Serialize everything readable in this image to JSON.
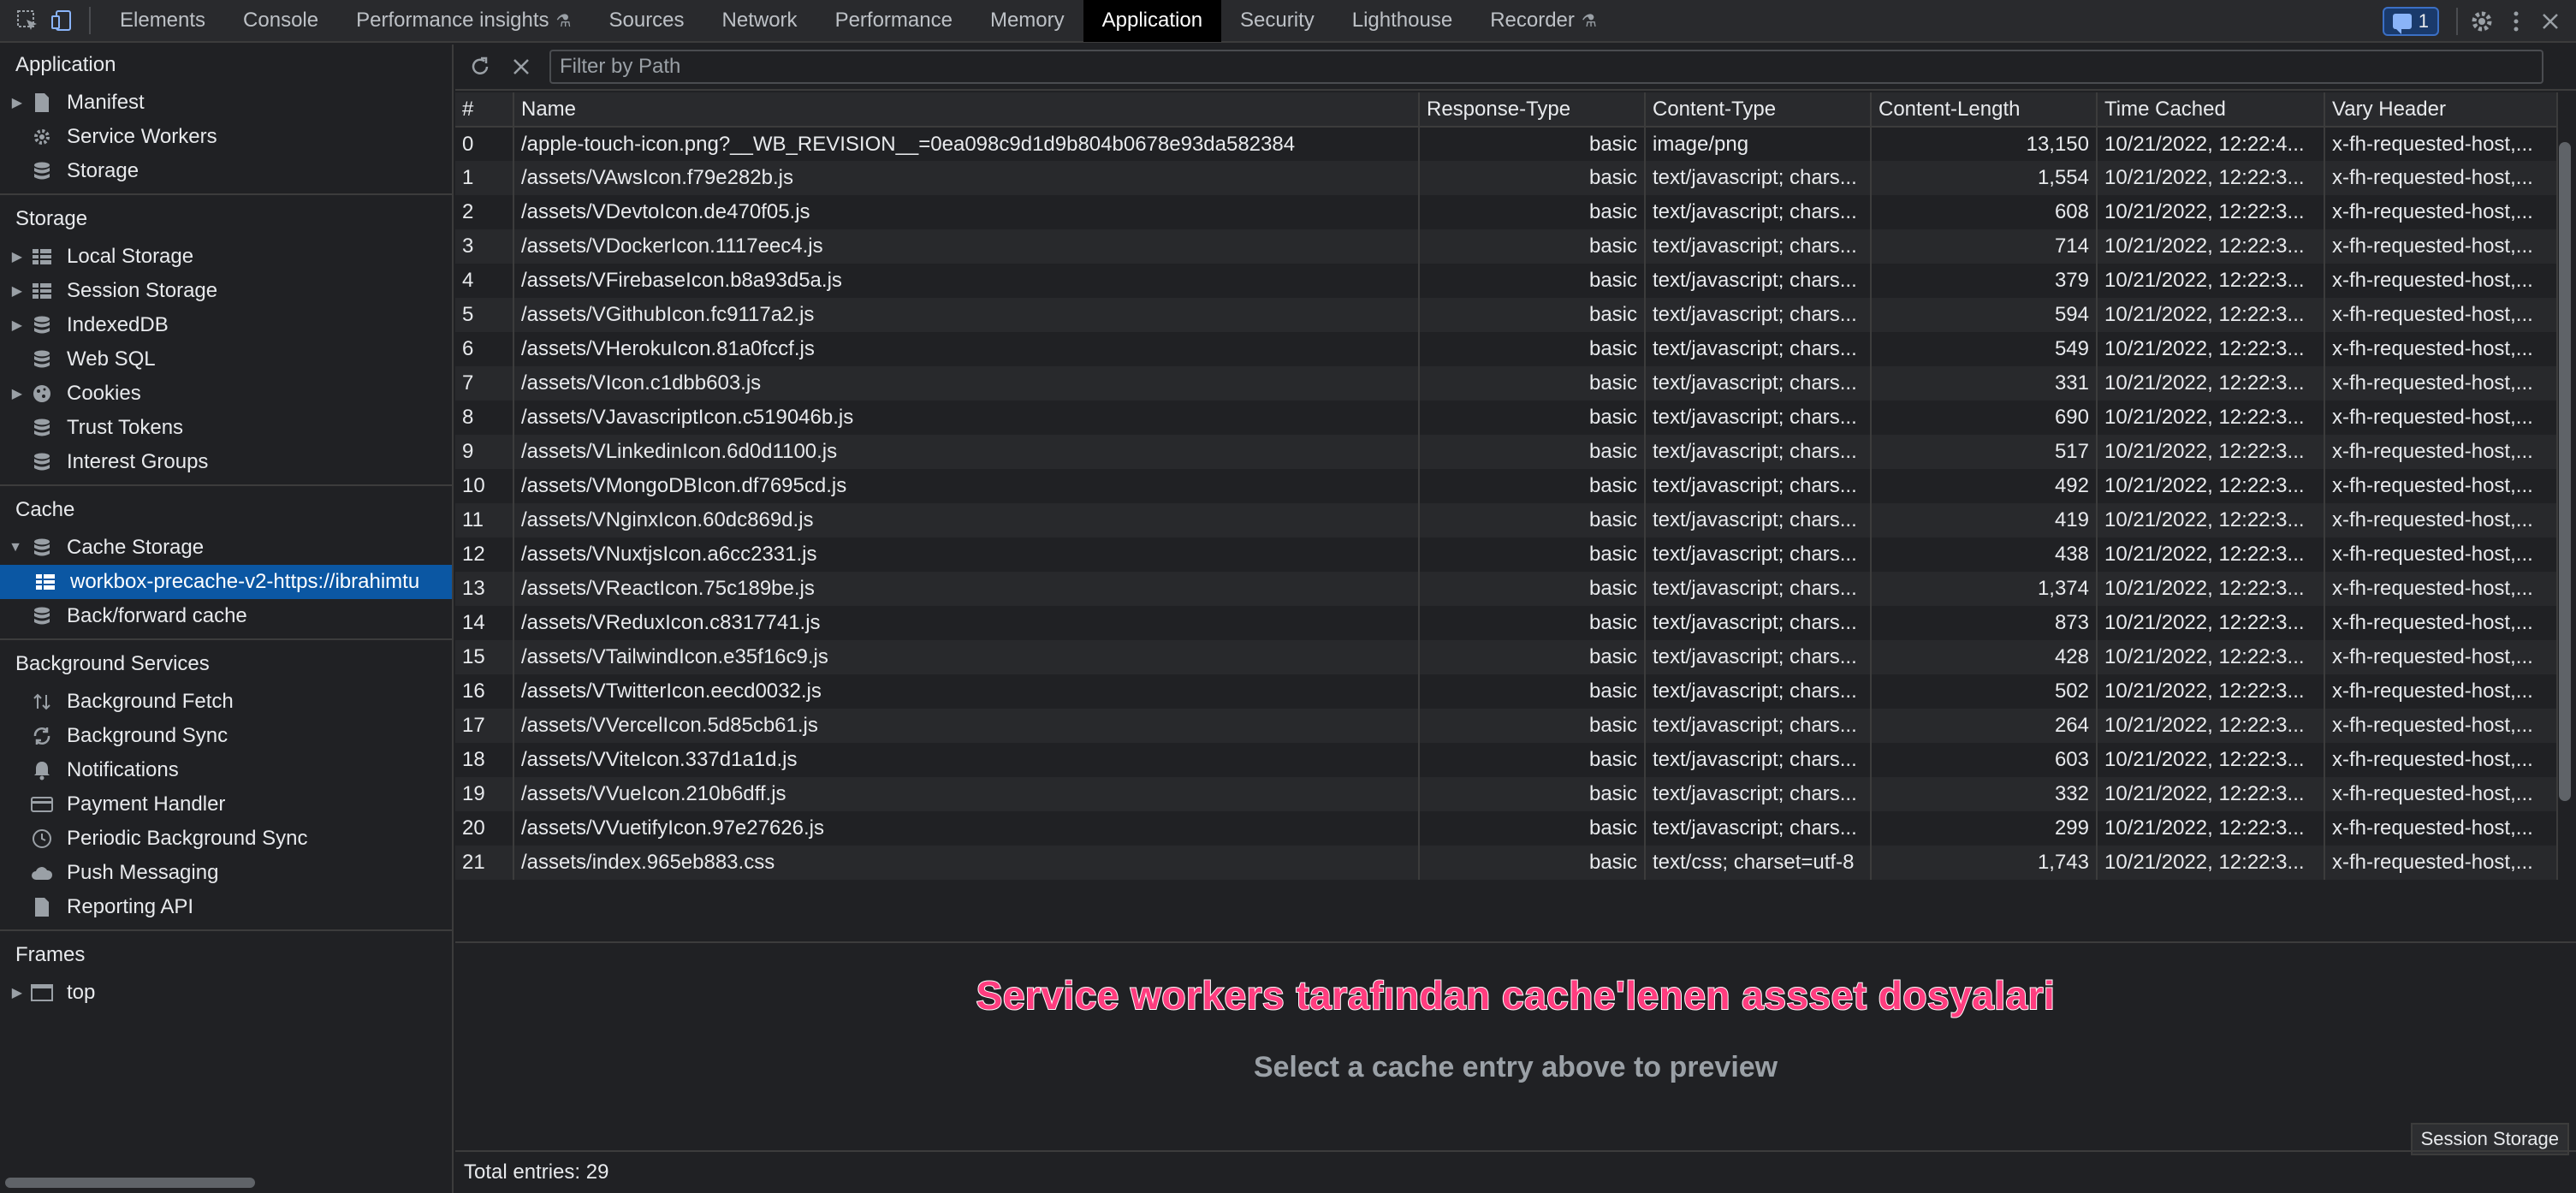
{
  "toolbar": {
    "tabs": [
      {
        "label": "Elements"
      },
      {
        "label": "Console"
      },
      {
        "label": "Performance insights",
        "experimental": true
      },
      {
        "label": "Sources"
      },
      {
        "label": "Network"
      },
      {
        "label": "Performance"
      },
      {
        "label": "Memory"
      },
      {
        "label": "Application",
        "active": true
      },
      {
        "label": "Security"
      },
      {
        "label": "Lighthouse"
      },
      {
        "label": "Recorder",
        "experimental": true
      }
    ],
    "issues_count": "1"
  },
  "sidebar": {
    "application": {
      "title": "Application",
      "items": [
        "Manifest",
        "Service Workers",
        "Storage"
      ]
    },
    "storage": {
      "title": "Storage",
      "items": [
        "Local Storage",
        "Session Storage",
        "IndexedDB",
        "Web SQL",
        "Cookies",
        "Trust Tokens",
        "Interest Groups"
      ]
    },
    "cache": {
      "title": "Cache",
      "items": [
        "Cache Storage",
        "workbox-precache-v2-https://ibrahimtu",
        "Back/forward cache"
      ]
    },
    "background": {
      "title": "Background Services",
      "items": [
        "Background Fetch",
        "Background Sync",
        "Notifications",
        "Payment Handler",
        "Periodic Background Sync",
        "Push Messaging",
        "Reporting API"
      ]
    },
    "frames": {
      "title": "Frames",
      "items": [
        "top"
      ]
    }
  },
  "filter": {
    "placeholder": "Filter by Path"
  },
  "table": {
    "headers": [
      "#",
      "Name",
      "Response-Type",
      "Content-Type",
      "Content-Length",
      "Time Cached",
      "Vary Header"
    ],
    "rows": [
      [
        "0",
        "/apple-touch-icon.png?__WB_REVISION__=0ea098c9d1d9b804b0678e93da582384",
        "basic",
        "image/png",
        "13,150",
        "10/21/2022, 12:22:4...",
        "x-fh-requested-host,..."
      ],
      [
        "1",
        "/assets/VAwsIcon.f79e282b.js",
        "basic",
        "text/javascript; chars...",
        "1,554",
        "10/21/2022, 12:22:3...",
        "x-fh-requested-host,..."
      ],
      [
        "2",
        "/assets/VDevtoIcon.de470f05.js",
        "basic",
        "text/javascript; chars...",
        "608",
        "10/21/2022, 12:22:3...",
        "x-fh-requested-host,..."
      ],
      [
        "3",
        "/assets/VDockerIcon.1117eec4.js",
        "basic",
        "text/javascript; chars...",
        "714",
        "10/21/2022, 12:22:3...",
        "x-fh-requested-host,..."
      ],
      [
        "4",
        "/assets/VFirebaseIcon.b8a93d5a.js",
        "basic",
        "text/javascript; chars...",
        "379",
        "10/21/2022, 12:22:3...",
        "x-fh-requested-host,..."
      ],
      [
        "5",
        "/assets/VGithubIcon.fc9117a2.js",
        "basic",
        "text/javascript; chars...",
        "594",
        "10/21/2022, 12:22:3...",
        "x-fh-requested-host,..."
      ],
      [
        "6",
        "/assets/VHerokuIcon.81a0fccf.js",
        "basic",
        "text/javascript; chars...",
        "549",
        "10/21/2022, 12:22:3...",
        "x-fh-requested-host,..."
      ],
      [
        "7",
        "/assets/VIcon.c1dbb603.js",
        "basic",
        "text/javascript; chars...",
        "331",
        "10/21/2022, 12:22:3...",
        "x-fh-requested-host,..."
      ],
      [
        "8",
        "/assets/VJavascriptIcon.c519046b.js",
        "basic",
        "text/javascript; chars...",
        "690",
        "10/21/2022, 12:22:3...",
        "x-fh-requested-host,..."
      ],
      [
        "9",
        "/assets/VLinkedinIcon.6d0d1100.js",
        "basic",
        "text/javascript; chars...",
        "517",
        "10/21/2022, 12:22:3...",
        "x-fh-requested-host,..."
      ],
      [
        "10",
        "/assets/VMongoDBIcon.df7695cd.js",
        "basic",
        "text/javascript; chars...",
        "492",
        "10/21/2022, 12:22:3...",
        "x-fh-requested-host,..."
      ],
      [
        "11",
        "/assets/VNginxIcon.60dc869d.js",
        "basic",
        "text/javascript; chars...",
        "419",
        "10/21/2022, 12:22:3...",
        "x-fh-requested-host,..."
      ],
      [
        "12",
        "/assets/VNuxtjsIcon.a6cc2331.js",
        "basic",
        "text/javascript; chars...",
        "438",
        "10/21/2022, 12:22:3...",
        "x-fh-requested-host,..."
      ],
      [
        "13",
        "/assets/VReactIcon.75c189be.js",
        "basic",
        "text/javascript; chars...",
        "1,374",
        "10/21/2022, 12:22:3...",
        "x-fh-requested-host,..."
      ],
      [
        "14",
        "/assets/VReduxIcon.c8317741.js",
        "basic",
        "text/javascript; chars...",
        "873",
        "10/21/2022, 12:22:3...",
        "x-fh-requested-host,..."
      ],
      [
        "15",
        "/assets/VTailwindIcon.e35f16c9.js",
        "basic",
        "text/javascript; chars...",
        "428",
        "10/21/2022, 12:22:3...",
        "x-fh-requested-host,..."
      ],
      [
        "16",
        "/assets/VTwitterIcon.eecd0032.js",
        "basic",
        "text/javascript; chars...",
        "502",
        "10/21/2022, 12:22:3...",
        "x-fh-requested-host,..."
      ],
      [
        "17",
        "/assets/VVercelIcon.5d85cb61.js",
        "basic",
        "text/javascript; chars...",
        "264",
        "10/21/2022, 12:22:3...",
        "x-fh-requested-host,..."
      ],
      [
        "18",
        "/assets/VViteIcon.337d1a1d.js",
        "basic",
        "text/javascript; chars...",
        "603",
        "10/21/2022, 12:22:3...",
        "x-fh-requested-host,..."
      ],
      [
        "19",
        "/assets/VVueIcon.210b6dff.js",
        "basic",
        "text/javascript; chars...",
        "332",
        "10/21/2022, 12:22:3...",
        "x-fh-requested-host,..."
      ],
      [
        "20",
        "/assets/VVuetifyIcon.97e27626.js",
        "basic",
        "text/javascript; chars...",
        "299",
        "10/21/2022, 12:22:3...",
        "x-fh-requested-host,..."
      ],
      [
        "21",
        "/assets/index.965eb883.css",
        "basic",
        "text/css; charset=utf-8",
        "1,743",
        "10/21/2022, 12:22:3...",
        "x-fh-requested-host,..."
      ]
    ]
  },
  "preview": {
    "annotation": "Service workers tarafından cache'lenen assset dosyalari",
    "message": "Select a cache entry above to preview",
    "session_chip": "Session Storage"
  },
  "footer": {
    "total": "Total entries: 29"
  },
  "colors": {
    "accent": "#0b57a3",
    "annotation": "#ff3d7f",
    "active_tab_bg": "#000000"
  }
}
